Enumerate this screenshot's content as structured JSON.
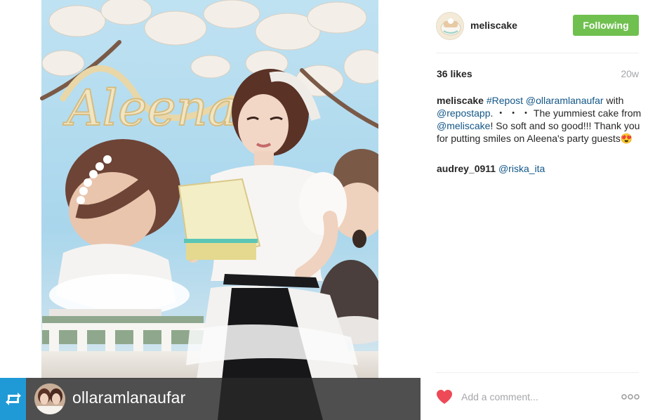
{
  "post": {
    "username": "meliscake",
    "follow_label": "Following",
    "likes": "36 likes",
    "age": "20w"
  },
  "caption": {
    "username": "meliscake",
    "hashtag": "#Repost",
    "mention_1": "@ollaramlanaufar",
    "text_1": " with ",
    "mention_2": "@repostapp",
    "text_2": ". ・ ・ ・ The yummiest cake from ",
    "mention_3": "@meliscake",
    "text_3": "! So soft and so good!!! Thank you for putting smiles on Aleena's party guests",
    "emoji": "😍"
  },
  "comments": [
    {
      "username": "audrey_0911",
      "mention": "@riska_ita"
    }
  ],
  "photo_overlay": {
    "repost_username": "ollaramlanaufar",
    "sign_text": "Aleena"
  },
  "footer": {
    "comment_placeholder": "Add a comment..."
  },
  "colors": {
    "follow_button": "#70c050",
    "link": "#125688",
    "heart": "#ed4956",
    "repost_badge": "#1f9ad6"
  },
  "icons": {
    "heart": "heart-icon",
    "more": "more-options-icon",
    "repost": "repost-icon"
  }
}
